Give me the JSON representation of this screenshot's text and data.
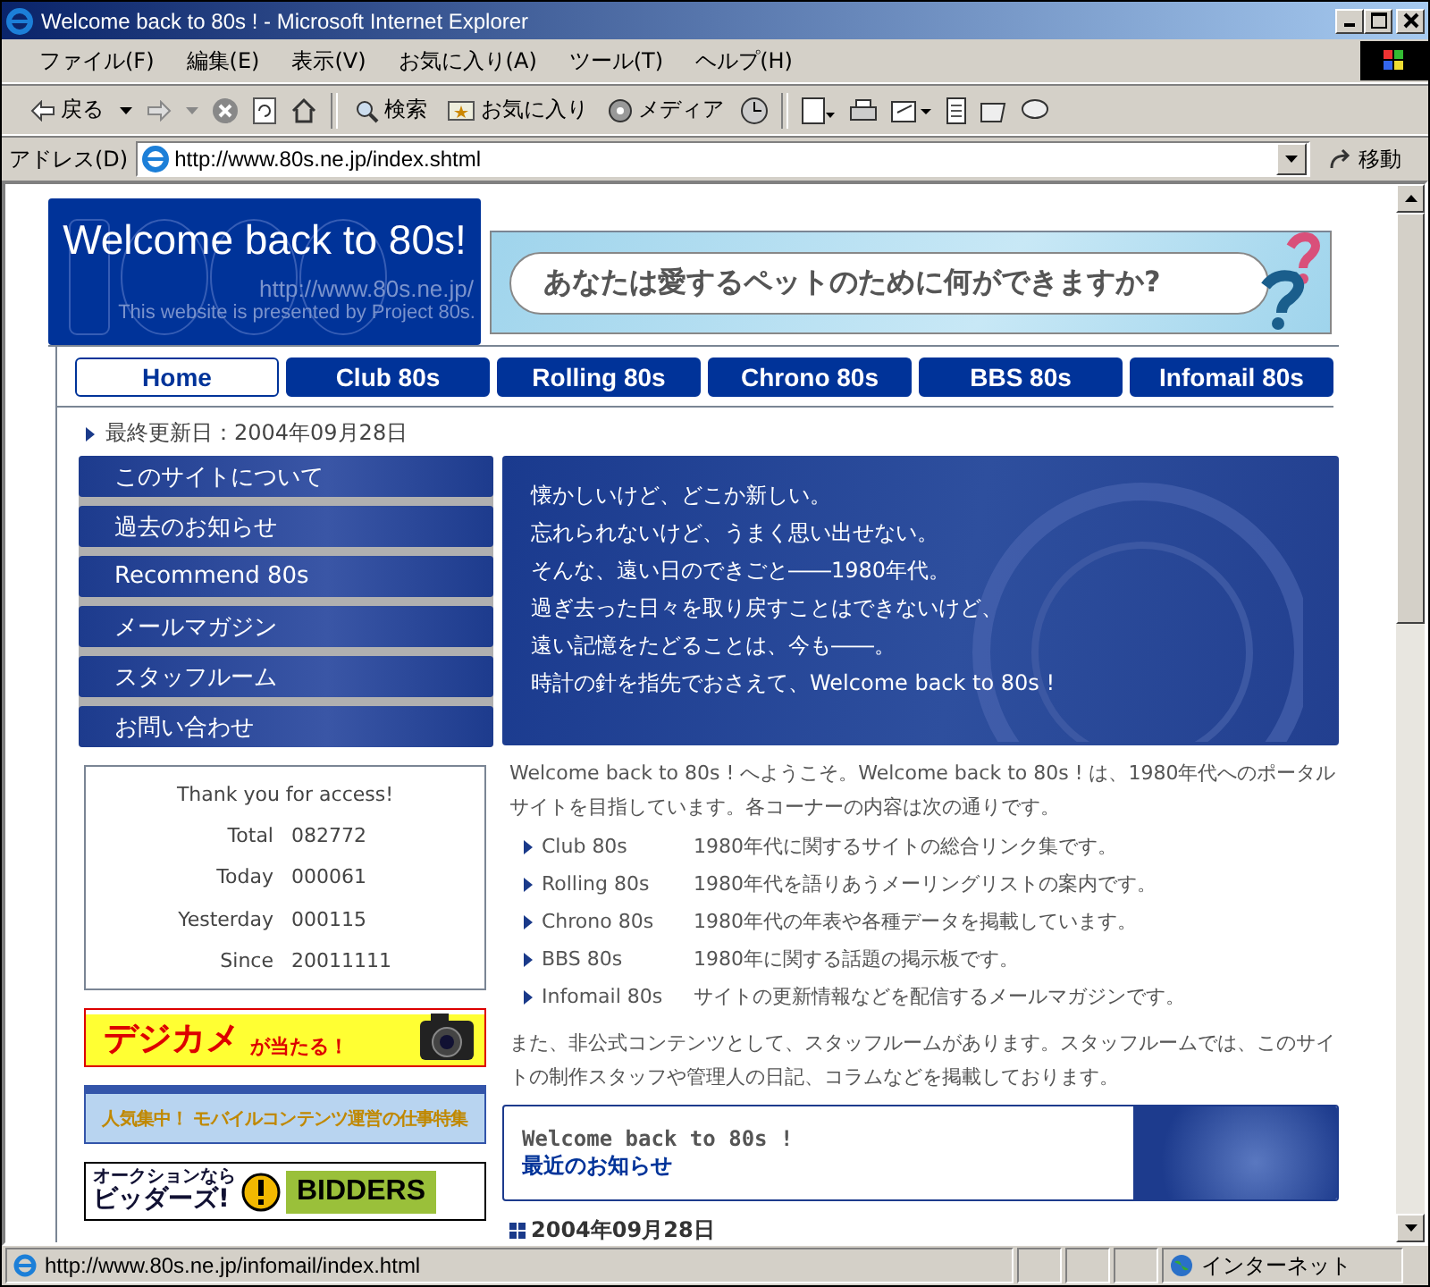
{
  "window": {
    "title": "Welcome back to 80s ! - Microsoft Internet Explorer"
  },
  "menu_bar": [
    "ファイル(F)",
    "編集(E)",
    "表示(V)",
    "お気に入り(A)",
    "ツール(T)",
    "ヘルプ(H)"
  ],
  "toolbar": {
    "back": "戻る",
    "search": "検索",
    "favorites": "お気に入り",
    "media": "メディア"
  },
  "address_bar": {
    "label": "アドレス(D)",
    "url": "http://www.80s.ne.jp/index.shtml",
    "go": "移動"
  },
  "page": {
    "logo": {
      "title": "Welcome back to 80s!",
      "url": "http://www.80s.ne.jp/",
      "credit": "This website is presented by Project 80s."
    },
    "banner": {
      "text": "あなたは愛するペットのために何ができますか?"
    },
    "nav_tabs": [
      {
        "label": "Home",
        "selected": true
      },
      {
        "label": "Club 80s",
        "selected": false
      },
      {
        "label": "Rolling 80s",
        "selected": false
      },
      {
        "label": "Chrono 80s",
        "selected": false
      },
      {
        "label": "BBS 80s",
        "selected": false
      },
      {
        "label": "Infomail 80s",
        "selected": false
      }
    ],
    "last_updated": "最終更新日：2004年09月28日",
    "side_menu": [
      "このサイトについて",
      "過去のお知らせ",
      "Recommend 80s",
      "メールマガジン",
      "スタッフルーム",
      "お問い合わせ"
    ],
    "intro_lines": [
      "懐かしいけど、どこか新しい。",
      "忘れられないけど、うまく思い出せない。",
      "そんな、遠い日のできごと――1980年代。",
      "過ぎ去った日々を取り戻すことはできないけど、",
      "遠い記憶をたどることは、今も――。",
      "時計の針を指先でおさえて、Welcome back to 80s !"
    ],
    "counter": {
      "heading": "Thank you for access!",
      "rows": [
        {
          "label": "Total",
          "value": "082772"
        },
        {
          "label": "Today",
          "value": "000061"
        },
        {
          "label": "Yesterday",
          "value": "000115"
        },
        {
          "label": "Since",
          "value": "20011111"
        }
      ]
    },
    "ads": {
      "camera": {
        "title": "デジカメ",
        "sub": "が当たる！"
      },
      "mobile": {
        "text": "人気集中！ モバイルコンテンツ運営の仕事特集"
      },
      "auction": {
        "line1": "オークションなら",
        "line2": "ビッダーズ!",
        "brand": "BIDDERS"
      }
    },
    "welcome": "Welcome back to 80s ! へようこそ。Welcome back to 80s ! は、1980年代へのポータルサイトを目指しています。各コーナーの内容は次の通りです。",
    "corners": [
      {
        "name": "Club 80s",
        "desc": "1980年代に関するサイトの総合リンク集です。"
      },
      {
        "name": "Rolling 80s",
        "desc": "1980年代を語りあうメーリングリストの案内です。"
      },
      {
        "name": "Chrono 80s",
        "desc": "1980年代の年表や各種データを掲載しています。"
      },
      {
        "name": "BBS  80s",
        "desc": "1980年に関する話題の掲示板です。"
      },
      {
        "name": "Infomail 80s",
        "desc": "サイトの更新情報などを配信するメールマガジンです。"
      }
    ],
    "staff_note": "また、非公式コンテンツとして、スタッフルームがあります。スタッフルームでは、このサイトの制作スタッフや管理人の日記、コラムなどを掲載しております。",
    "news_box": {
      "title": "Welcome back to 80s !",
      "link": "最近のお知らせ"
    },
    "news_date": "2004年09月28日"
  },
  "status_bar": {
    "url": "http://www.80s.ne.jp/infomail/index.html",
    "zone": "インターネット"
  }
}
